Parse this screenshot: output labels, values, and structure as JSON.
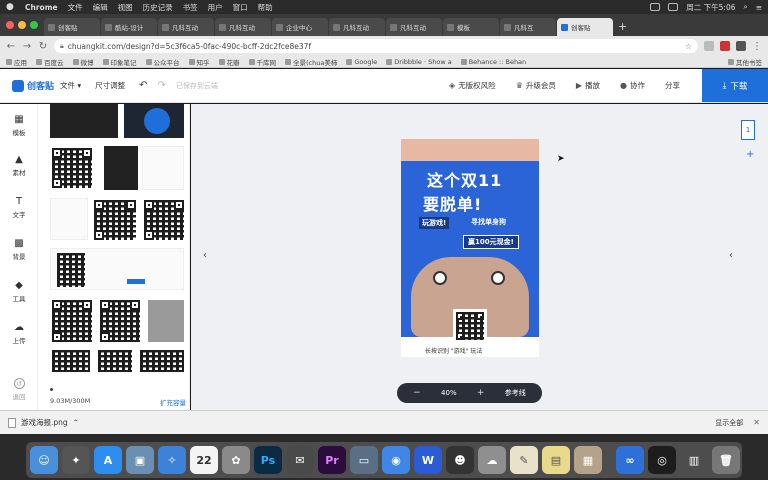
{
  "menubar": {
    "app": "Chrome",
    "items": [
      "文件",
      "编辑",
      "视图",
      "历史记录",
      "书签",
      "用户",
      "窗口",
      "帮助"
    ],
    "clock": "周二 下午5:06"
  },
  "tabs": [
    {
      "label": "创客贴",
      "active": false
    },
    {
      "label": "酷站-设计",
      "active": false
    },
    {
      "label": "凡科互动",
      "active": false
    },
    {
      "label": "凡科互动",
      "active": false
    },
    {
      "label": "企业中心",
      "active": false
    },
    {
      "label": "凡科互动",
      "active": false
    },
    {
      "label": "凡科互动",
      "active": false
    },
    {
      "label": "模板",
      "active": false
    },
    {
      "label": "凡科互",
      "active": false
    },
    {
      "label": "创客贴",
      "active": true
    }
  ],
  "address": {
    "url": "chuangkit.com/design?d=5c3f6ca5-0fac-490c-bcff-2dc2fce8e37f"
  },
  "bookmarks": [
    "应用",
    "百度云",
    "微博",
    "印象笔记",
    "公众平台",
    "知乎",
    "花瓣",
    "千库网",
    "全景(chua美柿",
    "Google",
    "Dribbble · Show a",
    "Behance :: Behan"
  ],
  "bookmarks_other": "其他书签",
  "header": {
    "logo": "创客贴",
    "file_menu": "文件 ▾",
    "resize": "尺寸调整",
    "saved": "已保存到云端",
    "risk": "无版权风险",
    "upgrade": "升级会员",
    "play": "播放",
    "collab": "协作",
    "share": "分享",
    "download": "下载"
  },
  "sidebar": [
    {
      "label": "模板",
      "icon": "template-icon"
    },
    {
      "label": "素材",
      "icon": "material-icon"
    },
    {
      "label": "文字",
      "icon": "text-icon"
    },
    {
      "label": "背景",
      "icon": "background-icon"
    },
    {
      "label": "工具",
      "icon": "tool-icon"
    },
    {
      "label": "上传",
      "icon": "upload-icon"
    },
    {
      "label": "退回",
      "icon": "back-icon"
    }
  ],
  "panel": {
    "usage": "9.03M/300M",
    "more": "扩充容量"
  },
  "poster": {
    "title_line1": "这个双11",
    "title_line2": "要脱单!",
    "sub_left": "玩游戏!",
    "sub_right": "寻找单身狗",
    "badge": "赢100元现金!",
    "caption": "长按识别 \"游戏\" 玩法"
  },
  "zoom": {
    "value": "40%",
    "guide": "参考线"
  },
  "page_number": "1",
  "download_shelf": {
    "file": "游戏海报.png",
    "show_all": "显示全部"
  },
  "dock": {
    "icons": [
      "finder-icon",
      "launchpad-icon",
      "appstore-icon",
      "preview-icon",
      "safari-icon",
      "calendar-icon",
      "photos-icon",
      "photoshop-icon",
      "mail-icon",
      "premiere-icon",
      "screen-icon",
      "chrome-icon",
      "wps-icon",
      "qq-icon",
      "wechat-icon",
      "notes-icon",
      "stickies-icon",
      "screenshot-icon",
      "baidu-icon",
      "quicktime-icon",
      "folder-icon",
      "trash-icon"
    ],
    "calendar_day": "22",
    "ps_label": "Ps",
    "pr_label": "Pr"
  }
}
